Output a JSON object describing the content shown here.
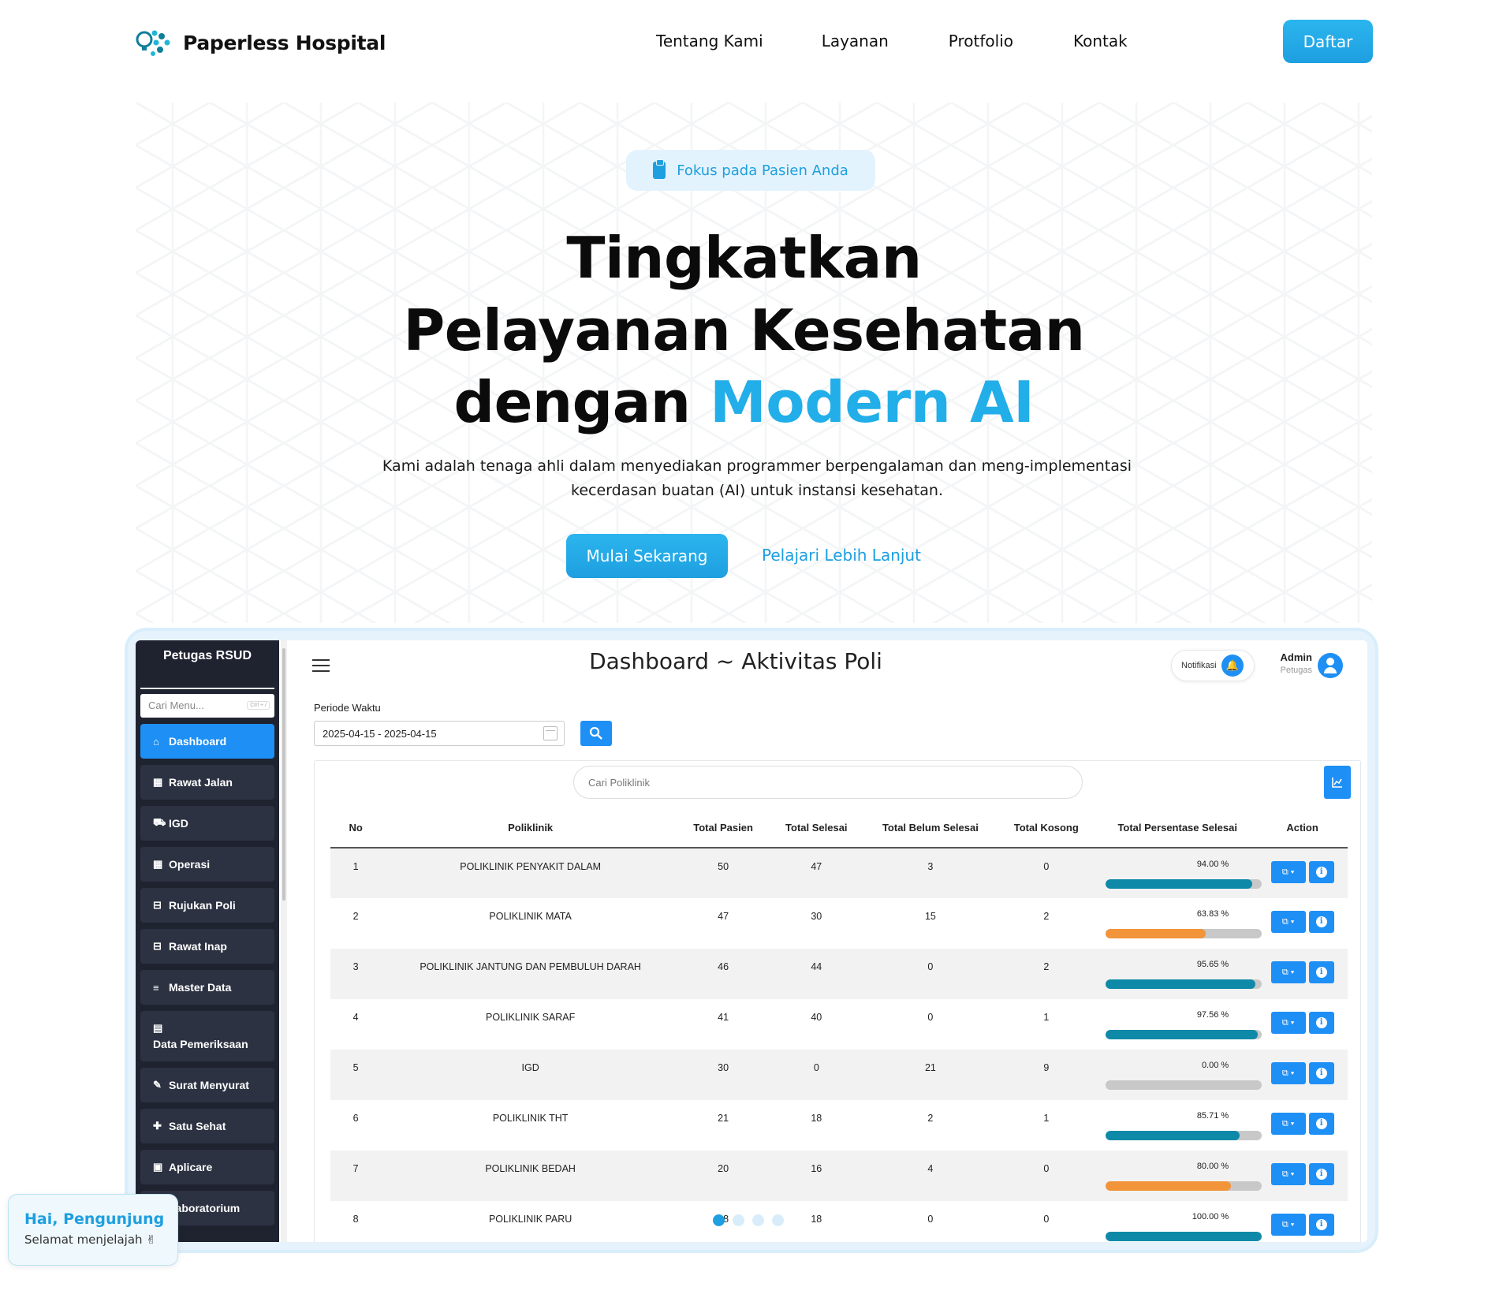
{
  "brand": {
    "name": "Paperless Hospital"
  },
  "nav": {
    "links": [
      "Tentang Kami",
      "Layanan",
      "Protfolio",
      "Kontak"
    ],
    "cta": "Daftar"
  },
  "hero": {
    "badge": "Fokus pada Pasien Anda",
    "title_line1": "Tingkatkan",
    "title_line2": "Pelayanan Kesehatan",
    "title_line3_plain": "dengan ",
    "title_line3_accent": "Modern AI",
    "description": "Kami adalah tenaga ahli dalam menyediakan programmer berpengalaman dan meng-implementasi kecerdasan buatan (AI) untuk instansi kesehatan.",
    "primary_cta": "Mulai Sekarang",
    "secondary_cta": "Pelajari Lebih Lanjut"
  },
  "dashboard": {
    "sidebar": {
      "title": "Petugas RSUD",
      "search_placeholder": "Cari Menu...",
      "search_shortcut": "Ctrl + /",
      "items": [
        {
          "label": "Dashboard",
          "icon": "home-icon",
          "active": true
        },
        {
          "label": "Rawat Jalan",
          "icon": "clinic-icon"
        },
        {
          "label": "IGD",
          "icon": "ambulance-icon"
        },
        {
          "label": "Operasi",
          "icon": "clinic-icon"
        },
        {
          "label": "Rujukan Poli",
          "icon": "bed-icon"
        },
        {
          "label": "Rawat Inap",
          "icon": "bed-icon"
        },
        {
          "label": "Master Data",
          "icon": "database-icon"
        },
        {
          "label": "Data Pemeriksaan",
          "icon": "table-icon"
        },
        {
          "label": "Surat Menyurat",
          "icon": "edit-icon"
        },
        {
          "label": "Satu Sehat",
          "icon": "medkit-icon"
        },
        {
          "label": "Aplicare",
          "icon": "hospital-icon"
        },
        {
          "label": "Laboratorium",
          "icon": "flask-icon"
        }
      ]
    },
    "header": {
      "title": "Dashboard ~ Aktivitas Poli",
      "notif_label": "Notifikasi",
      "user_name": "Admin",
      "user_role": "Petugas"
    },
    "filter": {
      "label": "Periode Waktu",
      "value": "2025-04-15 - 2025-04-15"
    },
    "table": {
      "search_placeholder": "Cari Poliklinik",
      "columns": [
        "No",
        "Poliklinik",
        "Total Pasien",
        "Total Selesai",
        "Total Belum Selesai",
        "Total Kosong",
        "Total Persentase Selesai",
        "Action"
      ],
      "rows": [
        {
          "no": "1",
          "poli": "POLIKLINIK PENYAKIT DALAM",
          "pasien": "50",
          "selesai": "47",
          "belum": "3",
          "kosong": "0",
          "pct_label": "94.00 %",
          "pct": 94.0,
          "color": "#0e8aa8"
        },
        {
          "no": "2",
          "poli": "POLIKLINIK MATA",
          "pasien": "47",
          "selesai": "30",
          "belum": "15",
          "kosong": "2",
          "pct_label": "63.83 %",
          "pct": 63.83,
          "color": "#f2943a"
        },
        {
          "no": "3",
          "poli": "POLIKLINIK JANTUNG DAN PEMBULUH DARAH",
          "pasien": "46",
          "selesai": "44",
          "belum": "0",
          "kosong": "2",
          "pct_label": "95.65 %",
          "pct": 95.65,
          "color": "#0e8aa8"
        },
        {
          "no": "4",
          "poli": "POLIKLINIK SARAF",
          "pasien": "41",
          "selesai": "40",
          "belum": "0",
          "kosong": "1",
          "pct_label": "97.56 %",
          "pct": 97.56,
          "color": "#0e8aa8"
        },
        {
          "no": "5",
          "poli": "IGD",
          "pasien": "30",
          "selesai": "0",
          "belum": "21",
          "kosong": "9",
          "pct_label": "0.00 %",
          "pct": 0,
          "color": "#0e8aa8"
        },
        {
          "no": "6",
          "poli": "POLIKLINIK THT",
          "pasien": "21",
          "selesai": "18",
          "belum": "2",
          "kosong": "1",
          "pct_label": "85.71 %",
          "pct": 85.71,
          "color": "#0e8aa8"
        },
        {
          "no": "7",
          "poli": "POLIKLINIK BEDAH",
          "pasien": "20",
          "selesai": "16",
          "belum": "4",
          "kosong": "0",
          "pct_label": "80.00 %",
          "pct": 80.0,
          "color": "#f2943a"
        },
        {
          "no": "8",
          "poli": "POLIKLINIK PARU",
          "pasien": "18",
          "selesai": "18",
          "belum": "0",
          "kosong": "0",
          "pct_label": "100.00 %",
          "pct": 100.0,
          "color": "#0e8aa8"
        }
      ]
    }
  },
  "carousel": {
    "count": 4,
    "active": 0
  },
  "greeting": {
    "title": "Hai, Pengunjung",
    "subtitle": "Selamat menjelajah ✌"
  },
  "colors": {
    "accent": "#22aee8",
    "button": "#1e9fe0",
    "sidebar": "#1f2330",
    "primary": "#1e8ff5"
  }
}
